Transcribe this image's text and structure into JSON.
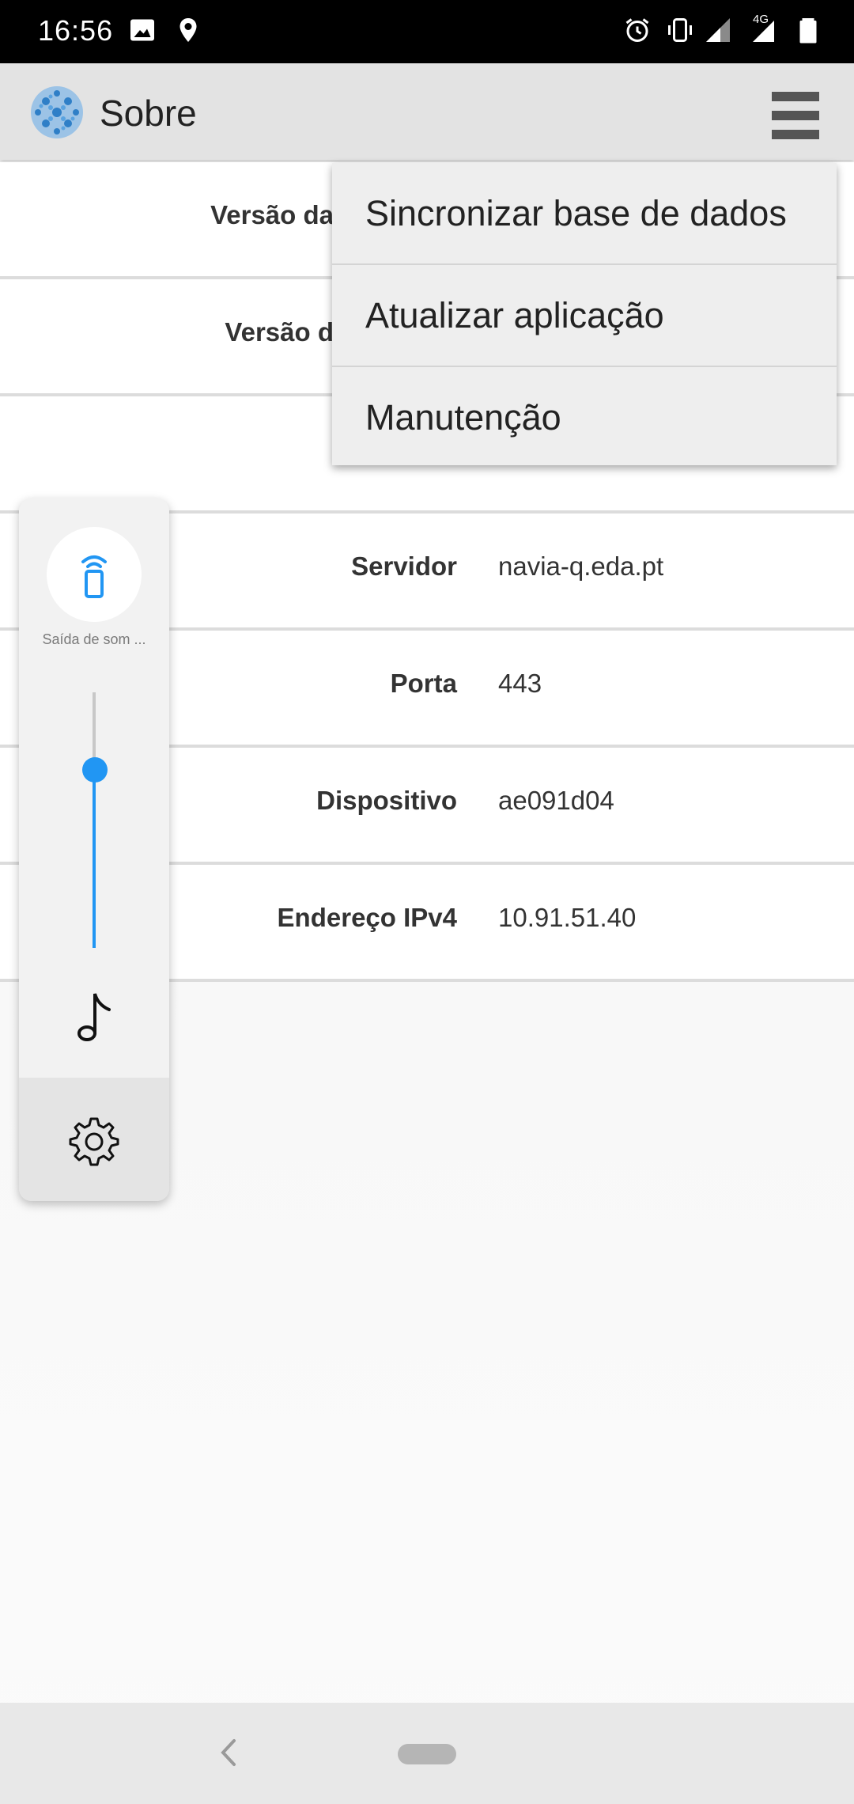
{
  "status_bar": {
    "time": "16:56",
    "network_label": "4G",
    "icons": [
      "image-icon",
      "location-icon",
      "alarm-icon",
      "vibrate-icon",
      "signal-icon",
      "signal-4g-icon",
      "battery-icon"
    ]
  },
  "app_bar": {
    "title": "Sobre",
    "logo_icon": "app-logo-icon",
    "menu_icon": "hamburger-menu-icon"
  },
  "info_rows": [
    {
      "label": "Versão da",
      "value": ""
    },
    {
      "label": "Versão d",
      "value": ""
    },
    {
      "label": "",
      "value": ""
    },
    {
      "label": "Servidor",
      "value": "navia-q.eda.pt"
    },
    {
      "label": "Porta",
      "value": "443"
    },
    {
      "label": "Dispositivo",
      "value": "ae091d04"
    },
    {
      "label": "Endereço IPv4",
      "value": "10.91.51.40"
    }
  ],
  "dropdown_menu": {
    "items": [
      {
        "label": "Sincronizar base de dados"
      },
      {
        "label": "Atualizar aplicação"
      },
      {
        "label": "Manutenção"
      }
    ]
  },
  "volume_panel": {
    "output_label": "Saída de som ...",
    "output_icon": "phone-speaker-icon",
    "volume_level": 0.7,
    "stream_icon": "music-note-icon",
    "settings_icon": "gear-icon"
  },
  "nav_bar": {
    "back_icon": "back-chevron-icon",
    "home_icon": "home-pill-icon"
  },
  "colors": {
    "accent": "#2196f3",
    "app_bar": "#e3e3e3",
    "status_bar": "#000000"
  }
}
